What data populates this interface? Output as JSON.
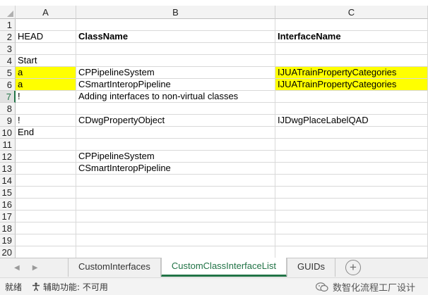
{
  "columns": [
    "A",
    "B",
    "C"
  ],
  "rows": [
    {
      "num": "1",
      "a": "",
      "b": "",
      "c": ""
    },
    {
      "num": "2",
      "a": "HEAD",
      "b": "ClassName",
      "c": "InterfaceName"
    },
    {
      "num": "3",
      "a": "",
      "b": "",
      "c": ""
    },
    {
      "num": "4",
      "a": "Start",
      "b": "",
      "c": ""
    },
    {
      "num": "5",
      "a": "a",
      "b": "CPPipelineSystem",
      "c": "IJUATrainPropertyCategories"
    },
    {
      "num": "6",
      "a": "a",
      "b": "CSmartInteropPipeline",
      "c": "IJUATrainPropertyCategories"
    },
    {
      "num": "7",
      "a": "!",
      "b": "Adding interfaces to non-virtual classes",
      "c": ""
    },
    {
      "num": "8",
      "a": "",
      "b": "",
      "c": ""
    },
    {
      "num": "9",
      "a": "!",
      "b": "CDwgPropertyObject",
      "c": "IJDwgPlaceLabelQAD"
    },
    {
      "num": "10",
      "a": "End",
      "b": "",
      "c": ""
    },
    {
      "num": "11",
      "a": "",
      "b": "",
      "c": ""
    },
    {
      "num": "12",
      "a": "",
      "b": "CPPipelineSystem",
      "c": ""
    },
    {
      "num": "13",
      "a": "",
      "b": "CSmartInteropPipeline",
      "c": ""
    },
    {
      "num": "14",
      "a": "",
      "b": "",
      "c": ""
    },
    {
      "num": "15",
      "a": "",
      "b": "",
      "c": ""
    },
    {
      "num": "16",
      "a": "",
      "b": "",
      "c": ""
    },
    {
      "num": "17",
      "a": "",
      "b": "",
      "c": ""
    },
    {
      "num": "18",
      "a": "",
      "b": "",
      "c": ""
    },
    {
      "num": "19",
      "a": "",
      "b": "",
      "c": ""
    },
    {
      "num": "20",
      "a": "",
      "b": "",
      "c": ""
    }
  ],
  "sheet_tabs": [
    "CustomInterfaces",
    "CustomClassInterfaceList",
    "GUIDs"
  ],
  "active_tab": "CustomClassInterfaceList",
  "status": {
    "ready": "就绪",
    "accessibility": "辅助功能: 不可用"
  },
  "watermark": "数智化流程工厂设计",
  "colors": {
    "accent": "#217346",
    "highlight": "#ffff00"
  },
  "icons": [
    "sheet-prev-icon",
    "sheet-next-icon",
    "add-sheet-icon",
    "accessibility-icon",
    "wechat-logo-icon"
  ]
}
